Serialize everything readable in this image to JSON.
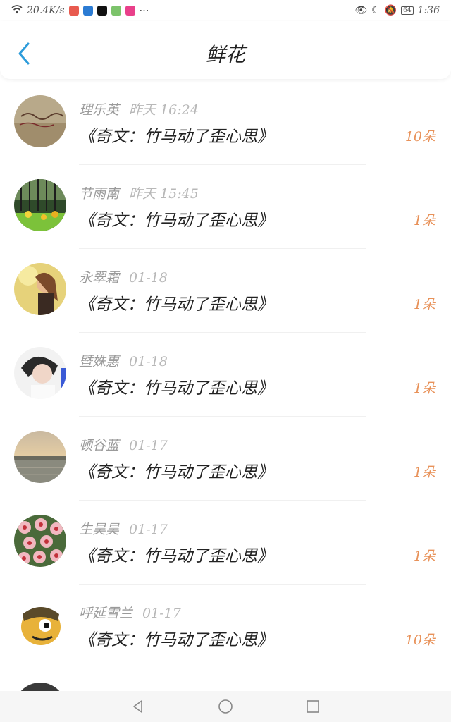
{
  "status_bar": {
    "speed": "20.4K/s",
    "time": "1:36",
    "battery": "64"
  },
  "header": {
    "title": "鲜花"
  },
  "items": [
    {
      "name": "理乐英",
      "time": "昨天 16:24",
      "book": "《奇文：竹马动了歪心思》",
      "count": "10朵"
    },
    {
      "name": "节雨南",
      "time": "昨天 15:45",
      "book": "《奇文：竹马动了歪心思》",
      "count": "1朵"
    },
    {
      "name": "永翠霜",
      "time": "01-18",
      "book": "《奇文：竹马动了歪心思》",
      "count": "1朵"
    },
    {
      "name": "暨姝惠",
      "time": "01-18",
      "book": "《奇文：竹马动了歪心思》",
      "count": "1朵"
    },
    {
      "name": "顿谷蓝",
      "time": "01-17",
      "book": "《奇文：竹马动了歪心思》",
      "count": "1朵"
    },
    {
      "name": "生昊昊",
      "time": "01-17",
      "book": "《奇文：竹马动了歪心思》",
      "count": "1朵"
    },
    {
      "name": "呼延雪兰",
      "time": "01-17",
      "book": "《奇文：竹马动了歪心思》",
      "count": "10朵"
    }
  ],
  "colors": {
    "accent_blue": "#2d9cdb",
    "count_orange": "#e8925a"
  }
}
